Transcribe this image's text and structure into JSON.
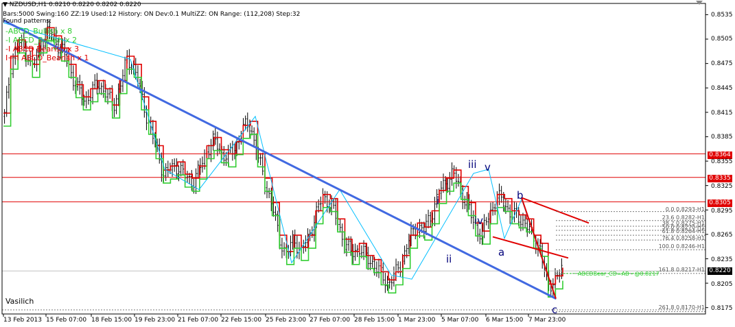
{
  "header": {
    "symbol_line": "NZDUSD,H1  0.8210 0.8220 0.8202 0.8220",
    "info_line": "Bars:5000  Swing:160  ZZ:19  Used:12  History: ON Dev:0.1  MultiZZ: ON  Range: (112,208)  Step:32",
    "found_label": "Found patterns:"
  },
  "patterns": [
    {
      "text": "-ABCD_Bullish x 8",
      "color": "#32cd32"
    },
    {
      "text": "-I ABCD_Bullish x 2",
      "color": "#32cd32"
    },
    {
      "text": "-I ABCD Bearish x 3",
      "color": "#e00000"
    },
    {
      "text": "I+-I ABCD_Bearish x 1",
      "color": "#e00000"
    }
  ],
  "corner_label": "Vasilich",
  "wave_labels": [
    {
      "text": "iii"
    },
    {
      "text": "v"
    },
    {
      "text": "i"
    },
    {
      "text": "iv"
    },
    {
      "text": "ii"
    },
    {
      "text": "a"
    },
    {
      "text": "b"
    },
    {
      "text": "c"
    }
  ],
  "fibo_levels": [
    {
      "text": "0.0  0.8293-H1"
    },
    {
      "text": "23.6  0.8282-H1"
    },
    {
      "text": "38.2  0.8275-H1"
    },
    {
      "text": "50.0  0.8270-H1"
    },
    {
      "text": "61.8  0.8264-H1"
    },
    {
      "text": "76.4  0.8258-H1"
    },
    {
      "text": "100.0  0.8246-H1"
    },
    {
      "text": "161.8  0.8217-H1"
    },
    {
      "text": "261.8  0.8170-H1"
    }
  ],
  "projection_label": "ABCDBear_CD=AB - @0.8217",
  "colors": {
    "bg": "#ffffff",
    "trendline": "#4169e1",
    "zigzag": "#00bfff",
    "red_line": "#e00000",
    "green_line": "#32cd32",
    "candles": "#000000",
    "price_box": "#000000",
    "level_box": "#e00000"
  },
  "chart_data": {
    "type": "candlestick",
    "symbol": "NZDUSD",
    "timeframe": "H1",
    "x_ticks": [
      "13 Feb 2013",
      "15 Feb 07:00",
      "18 Feb 15:00",
      "19 Feb 23:00",
      "21 Feb 07:00",
      "22 Feb 15:00",
      "25 Feb 23:00",
      "27 Feb 07:00",
      "28 Feb 15:00",
      "1 Mar 23:00",
      "5 Mar 07:00",
      "6 Mar 15:00",
      "7 Mar 23:00"
    ],
    "y_ticks": [
      0.8535,
      0.8505,
      0.8475,
      0.8445,
      0.8415,
      0.8385,
      0.8355,
      0.8325,
      0.8295,
      0.8265,
      0.8235,
      0.8205,
      0.8175
    ],
    "ylim": [
      0.8168,
      0.8548
    ],
    "current_price": "0.8220",
    "horizontal_levels": [
      "0.8364",
      "0.8335",
      "0.8305"
    ],
    "close_series": [
      0.841,
      0.848,
      0.85,
      0.849,
      0.847,
      0.85,
      0.8515,
      0.8505,
      0.849,
      0.847,
      0.8445,
      0.843,
      0.844,
      0.845,
      0.844,
      0.842,
      0.845,
      0.848,
      0.847,
      0.843,
      0.84,
      0.837,
      0.834,
      0.8345,
      0.835,
      0.8335,
      0.833,
      0.8345,
      0.837,
      0.838,
      0.8365,
      0.836,
      0.8375,
      0.8395,
      0.84,
      0.836,
      0.833,
      0.83,
      0.826,
      0.824,
      0.826,
      0.8245,
      0.826,
      0.829,
      0.831,
      0.8305,
      0.828,
      0.8255,
      0.824,
      0.825,
      0.8235,
      0.823,
      0.8215,
      0.8205,
      0.8215,
      0.8235,
      0.826,
      0.8275,
      0.827,
      0.829,
      0.8315,
      0.833,
      0.834,
      0.832,
      0.83,
      0.8275,
      0.8265,
      0.829,
      0.831,
      0.8305,
      0.829,
      0.8285,
      0.828,
      0.826,
      0.825,
      0.82,
      0.821,
      0.822
    ]
  }
}
